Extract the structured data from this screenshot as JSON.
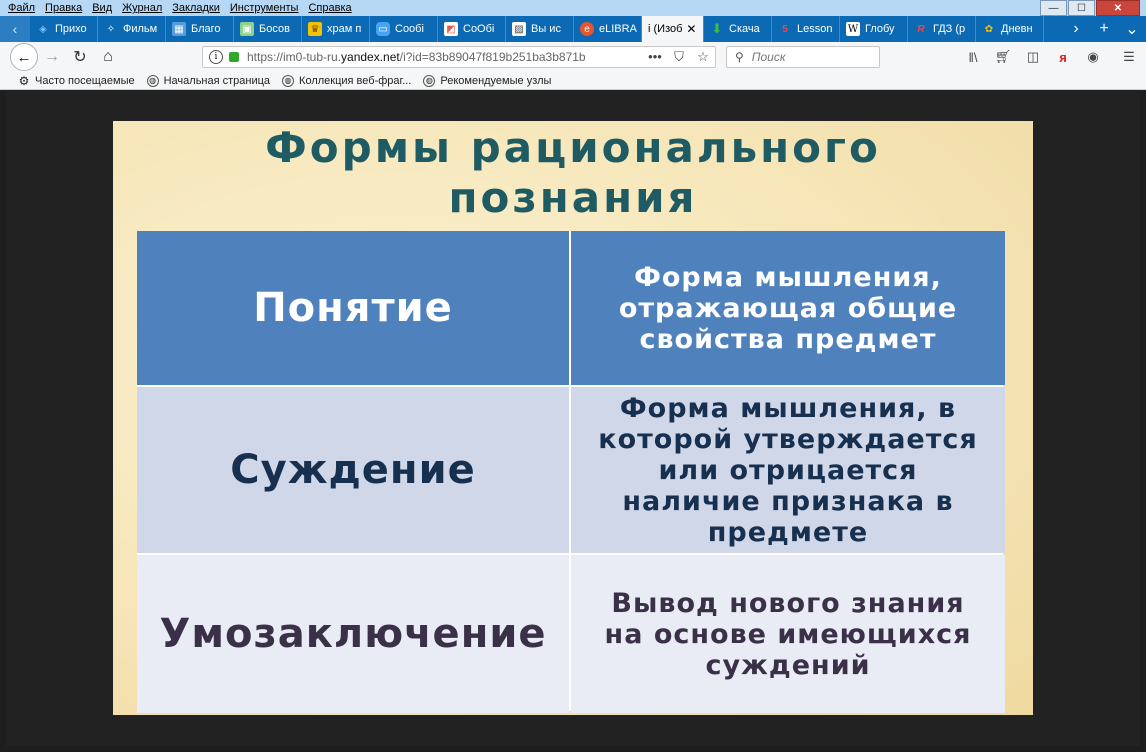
{
  "menu": [
    "Файл",
    "Правка",
    "Вид",
    "Журнал",
    "Закладки",
    "Инструменты",
    "Справка"
  ],
  "window_controls": {
    "minimize": "—",
    "maximize": "☐",
    "close": "✕"
  },
  "tabs": [
    {
      "label": "Прихо",
      "icon": "compass-icon",
      "color": "#7ec1ff"
    },
    {
      "label": "Фильм",
      "icon": "sparkle-icon",
      "color": "#ffffff"
    },
    {
      "label": "Благо",
      "icon": "chart-icon",
      "color": "#5a9ddc"
    },
    {
      "label": "Босов",
      "icon": "image-icon",
      "color": "#8fd18a"
    },
    {
      "label": "храм п",
      "icon": "crown-icon",
      "color": "#f2c200"
    },
    {
      "label": "Сообі",
      "icon": "chat-icon",
      "color": "#4aa3f0"
    },
    {
      "label": "СоОбі",
      "icon": "chart-icon",
      "color": "#e85a4f"
    },
    {
      "label": "Вы ис",
      "icon": "image-icon",
      "color": "#444444"
    },
    {
      "label": "eLIBRA",
      "icon": "elibrary-icon",
      "color": "#e8542f"
    },
    {
      "label": "i (Изоб",
      "icon": "",
      "color": "",
      "active": true
    },
    {
      "label": "Скача",
      "icon": "download-icon",
      "color": "#3fbf3f"
    },
    {
      "label": "Lesson",
      "icon": "lesson-icon",
      "color": "#e02020"
    },
    {
      "label": "Глобу",
      "icon": "wikipedia-icon",
      "color": "#ffffff"
    },
    {
      "label": "ГДЗ (р",
      "icon": "gdz-icon",
      "color": "#e02020"
    },
    {
      "label": "Дневн",
      "icon": "diary-icon",
      "color": "#f2c200"
    }
  ],
  "address": {
    "url_prefix": "https://im0-tub-ru.",
    "url_domain": "yandex.net",
    "url_rest": "/i?id=83b89047f819b251ba3b871b"
  },
  "search": {
    "placeholder": "Поиск"
  },
  "bookmarks": [
    "Часто посещаемые",
    "Начальная страница",
    "Коллекция веб-фраг...",
    "Рекомендуемые узлы"
  ],
  "slide": {
    "title_line1": "Формы рационального",
    "title_line2": "познания",
    "rows": [
      {
        "term": "Понятие",
        "definition": "Форма мышления, отражающая общие свойства предмет"
      },
      {
        "term": "Суждение",
        "definition": "Форма мышления, в которой утверждается или отрицается наличие признака в предмете"
      },
      {
        "term": "Умозаключение",
        "definition": "Вывод нового знания на основе имеющихся суждений"
      }
    ]
  }
}
